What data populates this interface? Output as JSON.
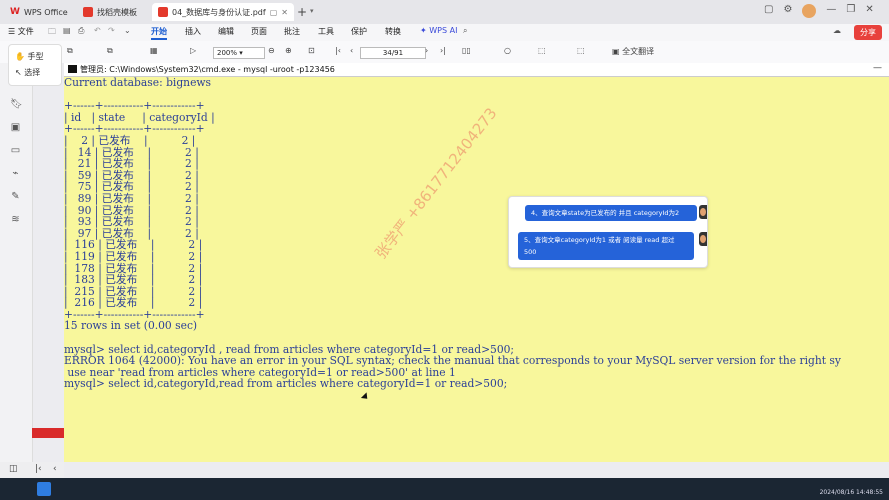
{
  "tabs": [
    {
      "label": "WPS Office",
      "active": false
    },
    {
      "label": "找稻壳模板",
      "active": false
    },
    {
      "label": "04_数据库与身份认证.pdf",
      "active": true
    }
  ],
  "menu": {
    "file": "文件",
    "items": [
      "开始",
      "插入",
      "编辑",
      "页面",
      "批注",
      "工具",
      "保护",
      "转换"
    ],
    "active": "开始",
    "wps_ai": "WPS AI",
    "share": "分享"
  },
  "ribbon": {
    "zoom": "200%",
    "page": "34/91",
    "translate": "全文翻译"
  },
  "hand_tool": {
    "hand": "手型",
    "select": "选择"
  },
  "cmd": {
    "title": "管理员: C:\\Windows\\System32\\cmd.exe - mysql  -uroot -p123456",
    "lines": [
      "Current database: bignews",
      "",
      "+------+-----------+------------+",
      "| id   | state     | categoryId |",
      "+------+-----------+------------+",
      "|    2 | 已发布    |          2 |",
      "|   14 | 已发布    |          2 |",
      "|   21 | 已发布    |          2 |",
      "|   59 | 已发布    |          2 |",
      "|   75 | 已发布    |          2 |",
      "|   89 | 已发布    |          2 |",
      "|   90 | 已发布    |          2 |",
      "|   93 | 已发布    |          2 |",
      "|   97 | 已发布    |          2 |",
      "|  116 | 已发布    |          2 |",
      "|  119 | 已发布    |          2 |",
      "|  178 | 已发布    |          2 |",
      "|  183 | 已发布    |          2 |",
      "|  215 | 已发布    |          2 |",
      "|  216 | 已发布    |          2 |",
      "+------+-----------+------------+",
      "15 rows in set (0.00 sec)",
      "",
      "mysql> select id,categoryId , read from articles where categoryId=1 or read>500;",
      "ERROR 1064 (42000): You have an error in your SQL syntax; check the manual that corresponds to your MySQL server version for the right sy",
      " use near 'read from articles where categoryId=1 or read>500' at line 1",
      "mysql> select id,categoryId,read from articles where categoryId=1 or read>500;"
    ]
  },
  "chat": [
    "4、查询文章state为已发布的 并且 categoryId为2",
    "5、查询文章categoryId为1 或者 阅读量 read  超过 500"
  ],
  "watermark": "张学严 +8617712404273",
  "clock": "2024/08/16 14:48:55"
}
